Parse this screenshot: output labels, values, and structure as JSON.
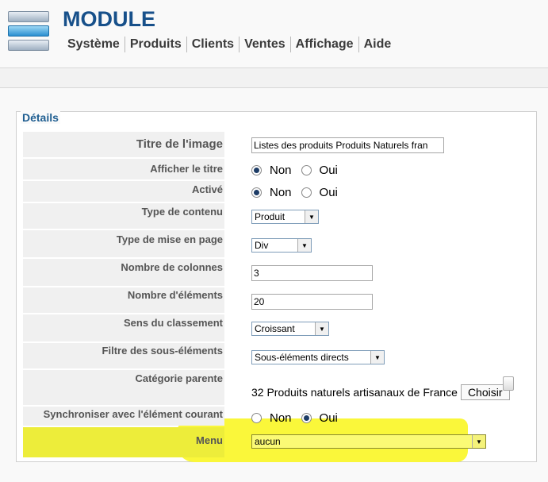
{
  "header": {
    "title": "MODULE",
    "menu": [
      "Système",
      "Produits",
      "Clients",
      "Ventes",
      "Affichage",
      "Aide"
    ]
  },
  "details": {
    "legend": "Détails",
    "title_label": "Titre de l'image",
    "title_value": "Listes des produits Produits Naturels fran",
    "show_title_label": "Afficher le titre",
    "active_label": "Activé",
    "content_type_label": "Type de contenu",
    "content_type_value": "Produit",
    "layout_label": "Type de mise en page",
    "layout_value": "Div",
    "columns_label": "Nombre de colonnes",
    "columns_value": "3",
    "items_label": "Nombre d'éléments",
    "items_value": "20",
    "sort_label": "Sens du classement",
    "sort_value": "Croissant",
    "filter_label": "Filtre des sous-éléments",
    "filter_value": "Sous-éléments directs",
    "parent_label": "Catégorie parente",
    "parent_value": "32 Produits naturels artisanaux de France",
    "choose_label": "Choisir",
    "sync_label": "Synchroniser avec l'élément courant",
    "menu_label": "Menu",
    "menu_value": "aucun",
    "no_label": "Non",
    "yes_label": "Oui"
  }
}
